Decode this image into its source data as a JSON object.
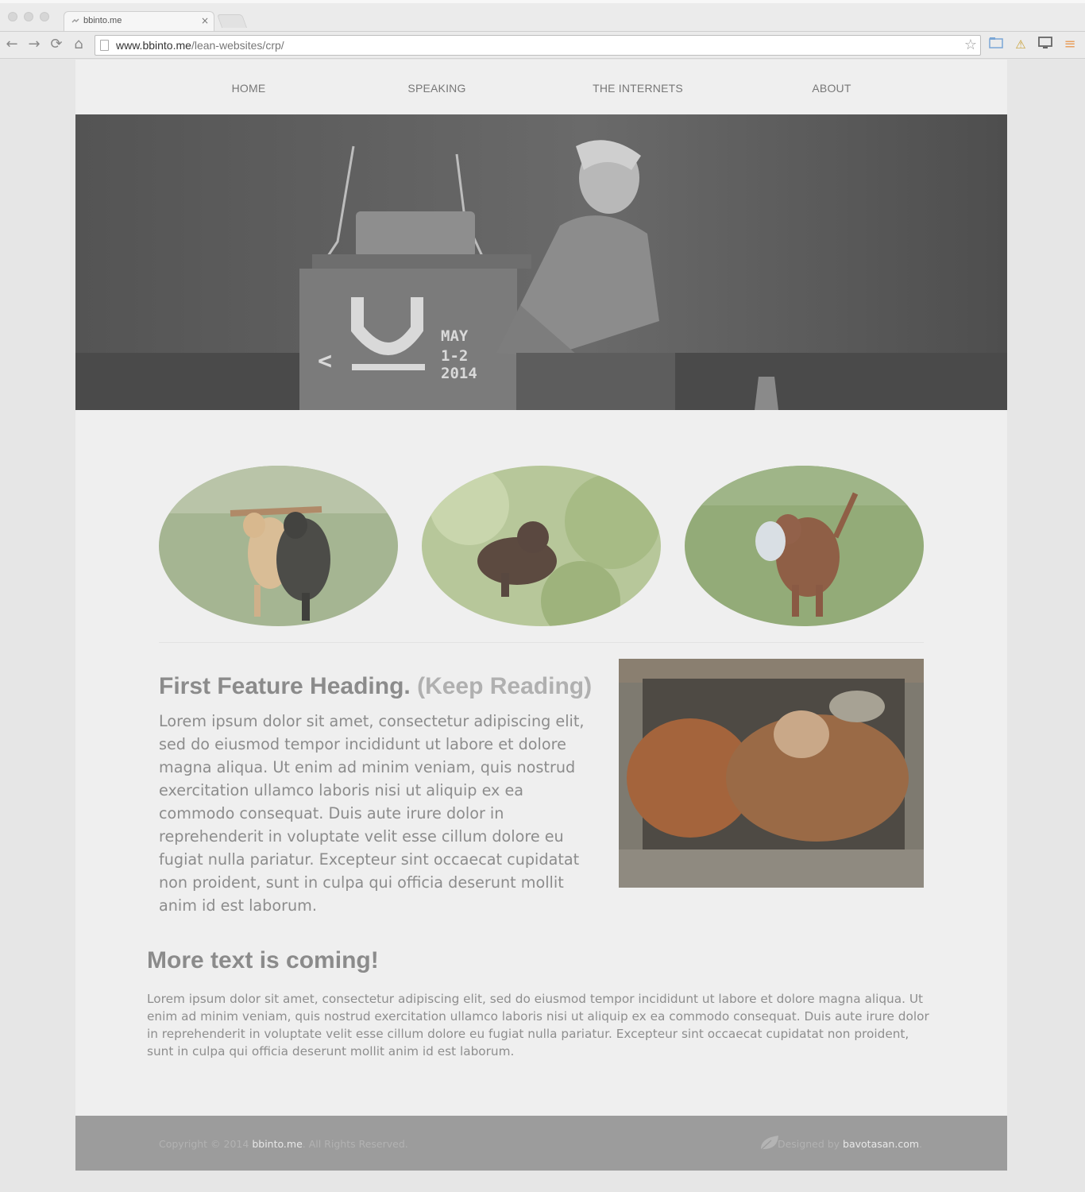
{
  "browser": {
    "tab_title": "bbinto.me",
    "tab_close": "×",
    "url_host": "www.bbinto.me",
    "url_path": "/lean-websites/crp/",
    "back_glyph": "←",
    "forward_glyph": "→",
    "reload_glyph": "⟳",
    "home_glyph": "⌂",
    "star_glyph": "☆",
    "warning_glyph": "⚠",
    "menu_glyph": "≡"
  },
  "nav": {
    "items": [
      "HOME",
      "SPEAKING",
      "THE INTERNETS",
      "ABOUT"
    ]
  },
  "hero": {
    "podium_text": [
      "MAY",
      "1-2",
      "2014"
    ],
    "podium_arrow": "<"
  },
  "feature": {
    "heading": "First Feature Heading.",
    "subheading": "(Keep Reading)",
    "body": "Lorem ipsum dolor sit amet, consectetur adipiscing elit, sed do eiusmod tempor incididunt ut labore et dolore magna aliqua. Ut enim ad minim veniam, quis nostrud exercitation ullamco laboris nisi ut aliquip ex ea commodo consequat. Duis aute irure dolor in reprehenderit in voluptate velit esse cillum dolore eu fugiat nulla pariatur. Excepteur sint occaecat cupidatat non proident, sunt in culpa qui officia deserunt mollit anim id est laborum."
  },
  "more": {
    "heading": "More text is coming!",
    "body": "Lorem ipsum dolor sit amet, consectetur adipiscing elit, sed do eiusmod tempor incididunt ut labore et dolore magna aliqua. Ut enim ad minim veniam, quis nostrud exercitation ullamco laboris nisi ut aliquip ex ea commodo consequat. Duis aute irure dolor in reprehenderit in voluptate velit esse cillum dolore eu fugiat nulla pariatur. Excepteur sint occaecat cupidatat non proident, sunt in culpa qui officia deserunt mollit anim id est laborum."
  },
  "footer": {
    "copyright_prefix": "Copyright © 2014",
    "site_link": "bbinto.me",
    "copyright_suffix": ". All Rights Reserved.",
    "designed_prefix": "Designed by",
    "designer_link": "bavotasan.com",
    "designed_suffix": "."
  },
  "colors": {
    "page_bg": "#efefef",
    "footer_bg": "#9c9c9c",
    "text": "#8c8c8c",
    "menu_icon": "#e8a060"
  }
}
